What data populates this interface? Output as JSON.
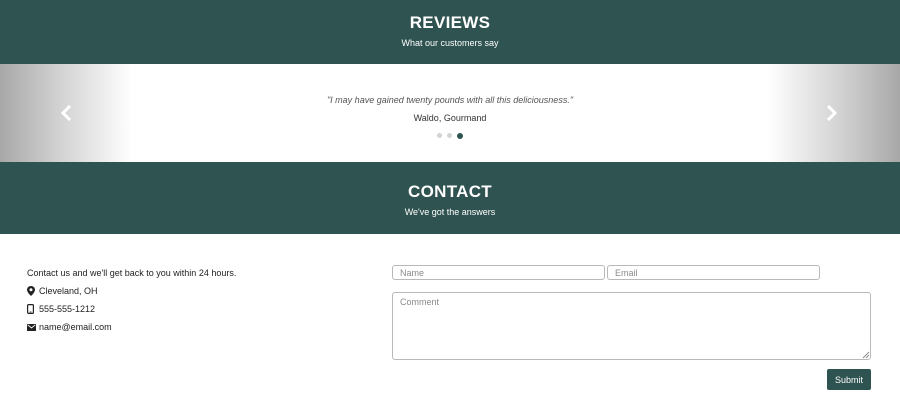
{
  "reviews": {
    "title": "REVIEWS",
    "subtitle": "What our customers say"
  },
  "carousel": {
    "quote": "\"I may have gained twenty pounds with all this deliciousness.\"",
    "author": "Waldo, Gourmand",
    "slide_count": 3,
    "active_slide": 3,
    "prev_icon": "chevron-left-icon",
    "next_icon": "chevron-right-icon"
  },
  "contact": {
    "title": "CONTACT",
    "subtitle": "We've got the answers",
    "intro": "Contact us and we'll get back to you within 24 hours.",
    "location": "Cleveland, OH",
    "phone": "555-555-1212",
    "email": "name@email.com"
  },
  "form": {
    "name_placeholder": "Name",
    "email_placeholder": "Email",
    "comment_placeholder": "Comment",
    "submit_label": "Submit"
  },
  "colors": {
    "band": "#2f5350",
    "dot_inactive": "#cfd4d6"
  }
}
